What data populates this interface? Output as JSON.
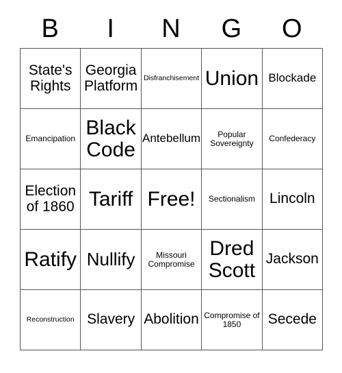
{
  "card": {
    "title_letters": [
      "B",
      "I",
      "N",
      "G",
      "O"
    ],
    "columns": [
      {
        "letter": "B"
      },
      {
        "letter": "I"
      },
      {
        "letter": "N"
      },
      {
        "letter": "G"
      },
      {
        "letter": "O"
      }
    ],
    "rows": [
      [
        {
          "text": "State's Rights",
          "size": "md"
        },
        {
          "text": "Georgia Platform",
          "size": "md"
        },
        {
          "text": "Disfranchisement",
          "size": "xxs"
        },
        {
          "text": "Union",
          "size": "xl"
        },
        {
          "text": "Blockade",
          "size": "sm"
        }
      ],
      [
        {
          "text": "Emancipation",
          "size": "xs"
        },
        {
          "text": "Black Code",
          "size": "xl"
        },
        {
          "text": "Antebellum",
          "size": "sm"
        },
        {
          "text": "Popular Sovereignty",
          "size": "xs"
        },
        {
          "text": "Confederacy",
          "size": "xs"
        }
      ],
      [
        {
          "text": "Election of 1860",
          "size": "md"
        },
        {
          "text": "Tariff",
          "size": "xl"
        },
        {
          "text": "Free!",
          "size": "xl"
        },
        {
          "text": "Sectionalism",
          "size": "xs"
        },
        {
          "text": "Lincoln",
          "size": "md"
        }
      ],
      [
        {
          "text": "Ratify",
          "size": "xl"
        },
        {
          "text": "Nullify",
          "size": "lg"
        },
        {
          "text": "Missouri Compromise",
          "size": "xs"
        },
        {
          "text": "Dred Scott",
          "size": "xl"
        },
        {
          "text": "Jackson",
          "size": "md"
        }
      ],
      [
        {
          "text": "Reconstruction",
          "size": "xxs"
        },
        {
          "text": "Slavery",
          "size": "md"
        },
        {
          "text": "Abolition",
          "size": "md"
        },
        {
          "text": "Compromise of 1850",
          "size": "xs"
        },
        {
          "text": "Secede",
          "size": "md"
        }
      ]
    ],
    "free_space": {
      "row": 2,
      "col": 2,
      "label": "Free!"
    },
    "colors": {
      "background": "#ffffff",
      "text": "#000000",
      "grid_line": "#555555"
    }
  }
}
